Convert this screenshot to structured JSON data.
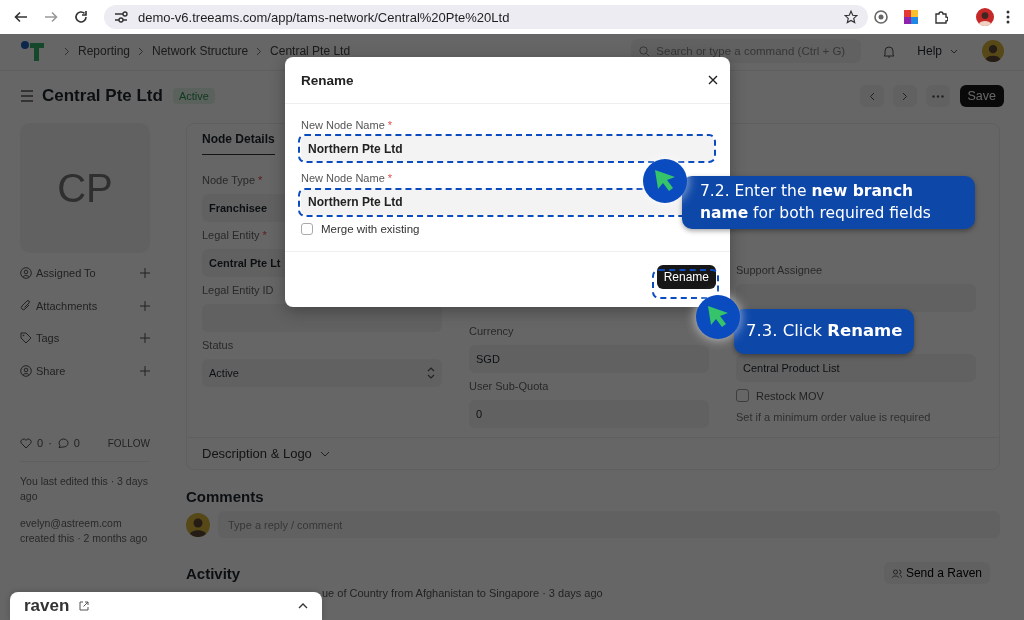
{
  "browser": {
    "url": "demo-v6.treeams.com/app/tams-network/Central%20Pte%20Ltd"
  },
  "navbar": {
    "breadcrumbs": [
      "Reporting",
      "Network Structure",
      "Central Pte Ltd"
    ],
    "search": {
      "placeholder": "Search or type a command (Ctrl + G)"
    },
    "help": "Help"
  },
  "header": {
    "title": "Central Pte Ltd",
    "status": "Active",
    "save": "Save"
  },
  "sidebar": {
    "avatar": "CP",
    "items": [
      {
        "label": "Assigned To"
      },
      {
        "label": "Attachments"
      },
      {
        "label": "Tags"
      },
      {
        "label": "Share"
      }
    ],
    "likes": "0",
    "separator": "·",
    "comments": "0",
    "follow": "FOLLOW",
    "edited": "You last edited this · 3 days ago",
    "created_by": "evelyn@astreem.com",
    "created": "created this · 2 months ago"
  },
  "form": {
    "tab": "Node Details",
    "columns": [
      [
        {
          "kind": "link",
          "label": "Node Type",
          "required_marker": "*",
          "value": "Franchisee"
        },
        {
          "kind": "link",
          "label": "Legal Entity",
          "required_marker": "*",
          "value": "Central Pte Lt"
        },
        {
          "kind": "input",
          "label": "Legal Entity ID"
        },
        {
          "kind": "select",
          "label": "Status",
          "value": "Active"
        }
      ],
      [
        {
          "kind": "input",
          "label": "Currency",
          "value": "SGD"
        },
        {
          "kind": "input",
          "label": "User Sub-Quota",
          "value": "0"
        }
      ],
      [
        {
          "kind": "input",
          "label": "Support Assignee"
        },
        {
          "kind": "input",
          "value": "Central Product List"
        },
        {
          "kind": "checkbox",
          "label": "Restock MOV",
          "checked": false,
          "description": "Set if a minimum order value is required"
        }
      ]
    ]
  },
  "section": {
    "title": "Description & Logo"
  },
  "comments": {
    "title": "Comments",
    "placeholder": "Type a reply / comment"
  },
  "activity": {
    "title": "Activity",
    "button": "Send a Raven",
    "entries": [
      "ue of Country from Afghanistan to Singapore · 3 days ago"
    ]
  },
  "raven": {
    "label": "raven"
  },
  "dialog": {
    "title": "Rename",
    "fields": [
      {
        "label": "New Node Name",
        "required_marker": "*",
        "value": "Northern Pte Ltd"
      },
      {
        "label": "New Node Name",
        "required_marker": "*",
        "value": "Northern Pte Ltd"
      }
    ],
    "merge": {
      "label": "Merge with existing",
      "checked": false
    },
    "button": "Rename"
  },
  "callouts": [
    {
      "text": "7.2. Enter the **new branch name** for both required fields"
    },
    {
      "text": "7.3. Click **Rename**"
    }
  ]
}
